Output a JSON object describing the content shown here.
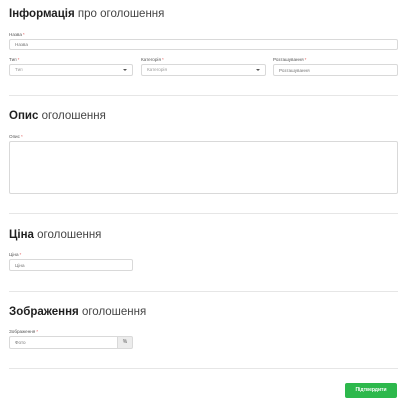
{
  "info": {
    "title_bold": "Інформація",
    "title_light": "про оголошення",
    "name_label": "Назва",
    "name_placeholder": "Назва",
    "type_label": "Тип",
    "type_placeholder": "Тип",
    "category_label": "Категорія",
    "category_placeholder": "Категорія",
    "location_label": "Розташування",
    "location_placeholder": "Розташування"
  },
  "description": {
    "title_bold": "Опис",
    "title_light": "оголошення",
    "label": "Опис"
  },
  "price": {
    "title_bold": "Ціна",
    "title_light": "оголошення",
    "label": "Ціна",
    "placeholder": "Ціна"
  },
  "images": {
    "title_bold": "Зображення",
    "title_light": "оголошення",
    "label": "Зображення",
    "placeholder": "Фото",
    "addon": "%"
  },
  "required_mark": "*",
  "submit_label": "Підтвердити",
  "colors": {
    "accent": "#2db84c",
    "required": "#e25c5c"
  }
}
